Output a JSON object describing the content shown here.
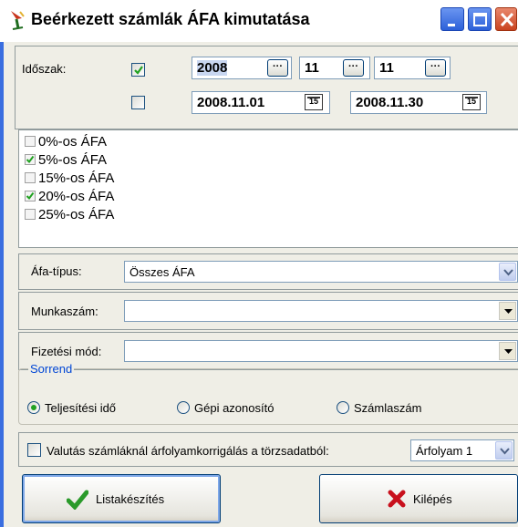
{
  "window": {
    "title": "Beérkezett számlák ÁFA kimutatása",
    "icons": {
      "app": "wine-glass-icon",
      "minimize": "minimize-icon",
      "maximize": "maximize-icon",
      "close": "close-icon"
    }
  },
  "period": {
    "label": "Időszak:",
    "row1_checked": true,
    "row2_checked": false,
    "year": "2008",
    "month": "11",
    "day": "11",
    "ellipsis_label": "···",
    "date_from": "2008.11.01",
    "date_to": "2008.11.30",
    "calendar_label": "15"
  },
  "vat_rates": [
    {
      "label": "0%-os ÁFA",
      "checked": false
    },
    {
      "label": "5%-os ÁFA",
      "checked": true
    },
    {
      "label": "15%-os ÁFA",
      "checked": false
    },
    {
      "label": "20%-os ÁFA",
      "checked": true
    },
    {
      "label": "25%-os ÁFA",
      "checked": false
    }
  ],
  "vat_type": {
    "label": "Áfa-típus:",
    "value": "Összes ÁFA"
  },
  "job_number": {
    "label": "Munkaszám:",
    "value": ""
  },
  "payment_method": {
    "label": "Fizetési mód:",
    "value": ""
  },
  "order": {
    "legend": "Sorrend",
    "options": [
      "Teljesítési idő",
      "Gépi azonosító",
      "Számlaszám"
    ],
    "selected": "Teljesítési idő"
  },
  "currency": {
    "checkbox_label": "Valutás számláknál árfolyamkorrigálás a törzsadatból:",
    "checked": false,
    "rate_value": "Árfolyam 1"
  },
  "buttons": {
    "list": "Listakészítés",
    "exit": "Kilépés",
    "list_icon": "checkmark-icon",
    "exit_icon": "x-mark-icon"
  },
  "colors": {
    "titlebar_bg": "#ffffff",
    "window_bg": "#efeee6",
    "accent": "#0046d5",
    "check_green": "#21a121",
    "exit_red": "#c8101c"
  }
}
